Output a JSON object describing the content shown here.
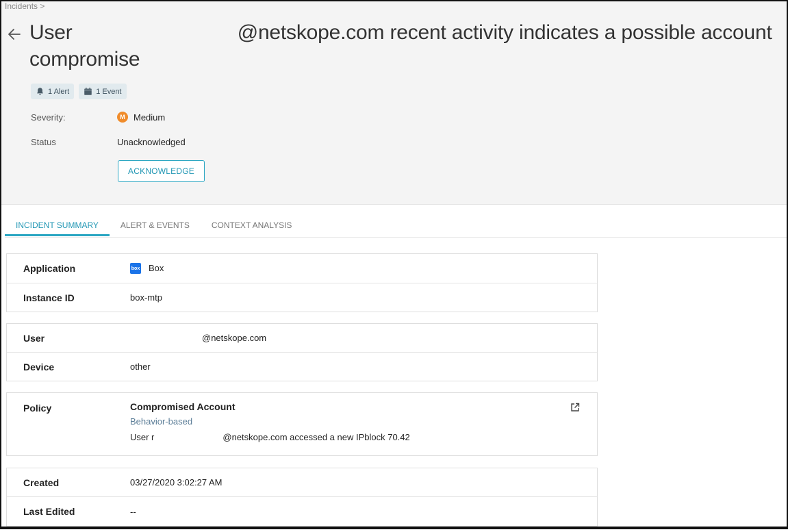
{
  "breadcrumb": "Incidents >",
  "title": {
    "prefix": "User",
    "suffix": "@netskope.com recent activity indicates a possible account compromise"
  },
  "chips": [
    {
      "icon": "bell-icon",
      "label": "1 Alert"
    },
    {
      "icon": "calendar-icon",
      "label": "1 Event"
    }
  ],
  "severity": {
    "label": "Severity:",
    "badge": "M",
    "value": "Medium",
    "color": "#f08c2b"
  },
  "status": {
    "label": "Status",
    "value": "Unacknowledged"
  },
  "acknowledge_button": "ACKNOWLEDGE",
  "tabs": [
    {
      "label": "INCIDENT SUMMARY",
      "active": true
    },
    {
      "label": "ALERT & EVENTS",
      "active": false
    },
    {
      "label": "CONTEXT ANALYSIS",
      "active": false
    }
  ],
  "summary": {
    "application": {
      "label": "Application",
      "value": "Box",
      "icon": "box"
    },
    "instance_id": {
      "label": "Instance ID",
      "value": "box-mtp"
    },
    "user": {
      "label": "User",
      "value": "@netskope.com"
    },
    "device": {
      "label": "Device",
      "value": "other"
    },
    "policy": {
      "label": "Policy",
      "name": "Compromised Account",
      "type": "Behavior-based",
      "desc_prefix": "User r",
      "desc_suffix": "@netskope.com accessed a new IPblock 70.42"
    },
    "created": {
      "label": "Created",
      "value": "03/27/2020 3:02:27 AM"
    },
    "last_edited": {
      "label": "Last Edited",
      "value": "--"
    }
  },
  "colors": {
    "accent": "#2aa6c2",
    "header_bg": "#f4f4f4",
    "chip_bg": "#e1eaee"
  }
}
